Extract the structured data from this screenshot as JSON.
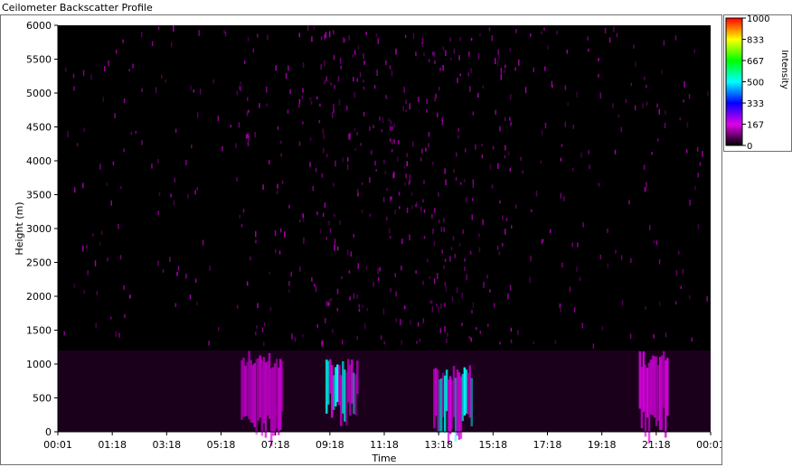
{
  "window": {
    "title": "Ceilometer Backscatter Profile"
  },
  "chart_data": {
    "type": "heatmap",
    "title": "",
    "xlabel": "Time",
    "ylabel": "Height (m)",
    "x_ticks": [
      "00:01",
      "01:18",
      "03:18",
      "05:18",
      "07:18",
      "09:18",
      "11:18",
      "13:18",
      "15:18",
      "17:18",
      "19:18",
      "21:18",
      "00:01"
    ],
    "y_ticks": [
      "0",
      "500",
      "1000",
      "1500",
      "2000",
      "2500",
      "3000",
      "3500",
      "4000",
      "4500",
      "5000",
      "5500",
      "6000"
    ],
    "ylim": [
      0,
      6000
    ],
    "colorbar": {
      "label": "Intensity",
      "ticks": [
        "1000",
        "833",
        "667",
        "500",
        "333",
        "167",
        "0"
      ],
      "range": [
        0,
        1000
      ],
      "stops": [
        "#000000",
        "#e000e8",
        "#0000ff",
        "#00ffff",
        "#00ff00",
        "#ffff00",
        "#ff0000"
      ]
    },
    "colors": {
      "background": "#000000",
      "signal": "#e000e8",
      "strong": "#00ffff"
    },
    "features": [
      {
        "name": "boundary-layer",
        "height_max": 1200,
        "intensity": 40
      },
      {
        "name": "cloud-07",
        "t_start": 0.28,
        "t_end": 0.345,
        "h_start": 0,
        "h_end": 1200,
        "intensity": 260
      },
      {
        "name": "cloud-10",
        "t_start": 0.41,
        "t_end": 0.46,
        "h_start": 300,
        "h_end": 1100,
        "intensity": 320
      },
      {
        "name": "cloud-14",
        "t_start": 0.575,
        "t_end": 0.635,
        "h_start": 0,
        "h_end": 1000,
        "intensity": 420
      },
      {
        "name": "cloud-22",
        "t_start": 0.89,
        "t_end": 0.935,
        "h_start": 0,
        "h_end": 1200,
        "intensity": 260
      }
    ]
  }
}
